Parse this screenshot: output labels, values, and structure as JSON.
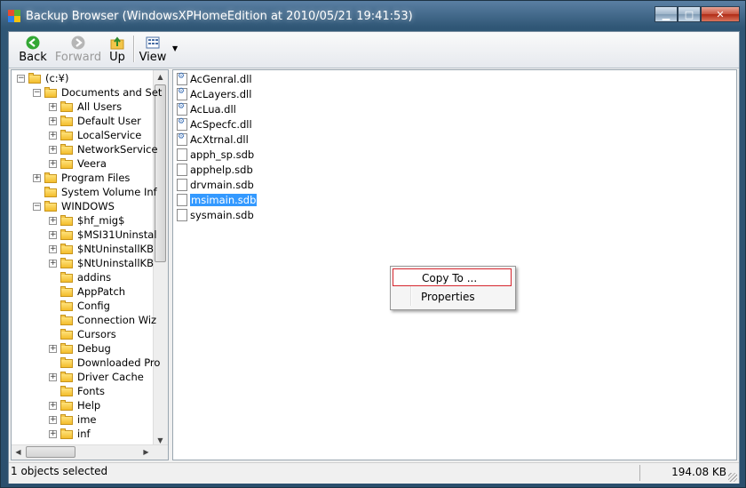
{
  "window": {
    "title": "Backup Browser (WindowsXPHomeEdition at 2010/05/21 19:41:53)"
  },
  "toolbar": {
    "back": "Back",
    "forward": "Forward",
    "up": "Up",
    "view": "View"
  },
  "tree": {
    "items": [
      {
        "label": "(c:¥)",
        "level": 0,
        "expander": "-"
      },
      {
        "label": "Documents and Set",
        "level": 1,
        "expander": "-"
      },
      {
        "label": "All Users",
        "level": 2,
        "expander": "+"
      },
      {
        "label": "Default User",
        "level": 2,
        "expander": "+"
      },
      {
        "label": "LocalService",
        "level": 2,
        "expander": "+"
      },
      {
        "label": "NetworkService",
        "level": 2,
        "expander": "+"
      },
      {
        "label": "Veera",
        "level": 2,
        "expander": "+"
      },
      {
        "label": "Program Files",
        "level": 1,
        "expander": "+"
      },
      {
        "label": "System Volume Inf",
        "level": 1,
        "expander": ""
      },
      {
        "label": "WINDOWS",
        "level": 1,
        "expander": "-"
      },
      {
        "label": "$hf_mig$",
        "level": 2,
        "expander": "+"
      },
      {
        "label": "$MSI31Uninstal",
        "level": 2,
        "expander": "+"
      },
      {
        "label": "$NtUninstallKB",
        "level": 2,
        "expander": "+"
      },
      {
        "label": "$NtUninstallKB",
        "level": 2,
        "expander": "+"
      },
      {
        "label": "addins",
        "level": 2,
        "expander": ""
      },
      {
        "label": "AppPatch",
        "level": 2,
        "expander": ""
      },
      {
        "label": "Config",
        "level": 2,
        "expander": ""
      },
      {
        "label": "Connection Wiz",
        "level": 2,
        "expander": ""
      },
      {
        "label": "Cursors",
        "level": 2,
        "expander": ""
      },
      {
        "label": "Debug",
        "level": 2,
        "expander": "+"
      },
      {
        "label": "Downloaded Pro",
        "level": 2,
        "expander": ""
      },
      {
        "label": "Driver Cache",
        "level": 2,
        "expander": "+"
      },
      {
        "label": "Fonts",
        "level": 2,
        "expander": ""
      },
      {
        "label": "Help",
        "level": 2,
        "expander": "+"
      },
      {
        "label": "ime",
        "level": 2,
        "expander": "+"
      },
      {
        "label": "inf",
        "level": 2,
        "expander": "+"
      }
    ]
  },
  "files": [
    {
      "name": "AcGenral.dll",
      "type": "dll"
    },
    {
      "name": "AcLayers.dll",
      "type": "dll"
    },
    {
      "name": "AcLua.dll",
      "type": "dll"
    },
    {
      "name": "AcSpecfc.dll",
      "type": "dll"
    },
    {
      "name": "AcXtrnal.dll",
      "type": "dll"
    },
    {
      "name": "apph_sp.sdb",
      "type": "sdb"
    },
    {
      "name": "apphelp.sdb",
      "type": "sdb"
    },
    {
      "name": "drvmain.sdb",
      "type": "sdb"
    },
    {
      "name": "msimain.sdb",
      "type": "sdb",
      "selected": true
    },
    {
      "name": "sysmain.sdb",
      "type": "sdb"
    }
  ],
  "context_menu": {
    "items": [
      "Copy To ...",
      "Properties"
    ]
  },
  "status": {
    "left": "1 objects selected",
    "right": "194.08  KB"
  }
}
